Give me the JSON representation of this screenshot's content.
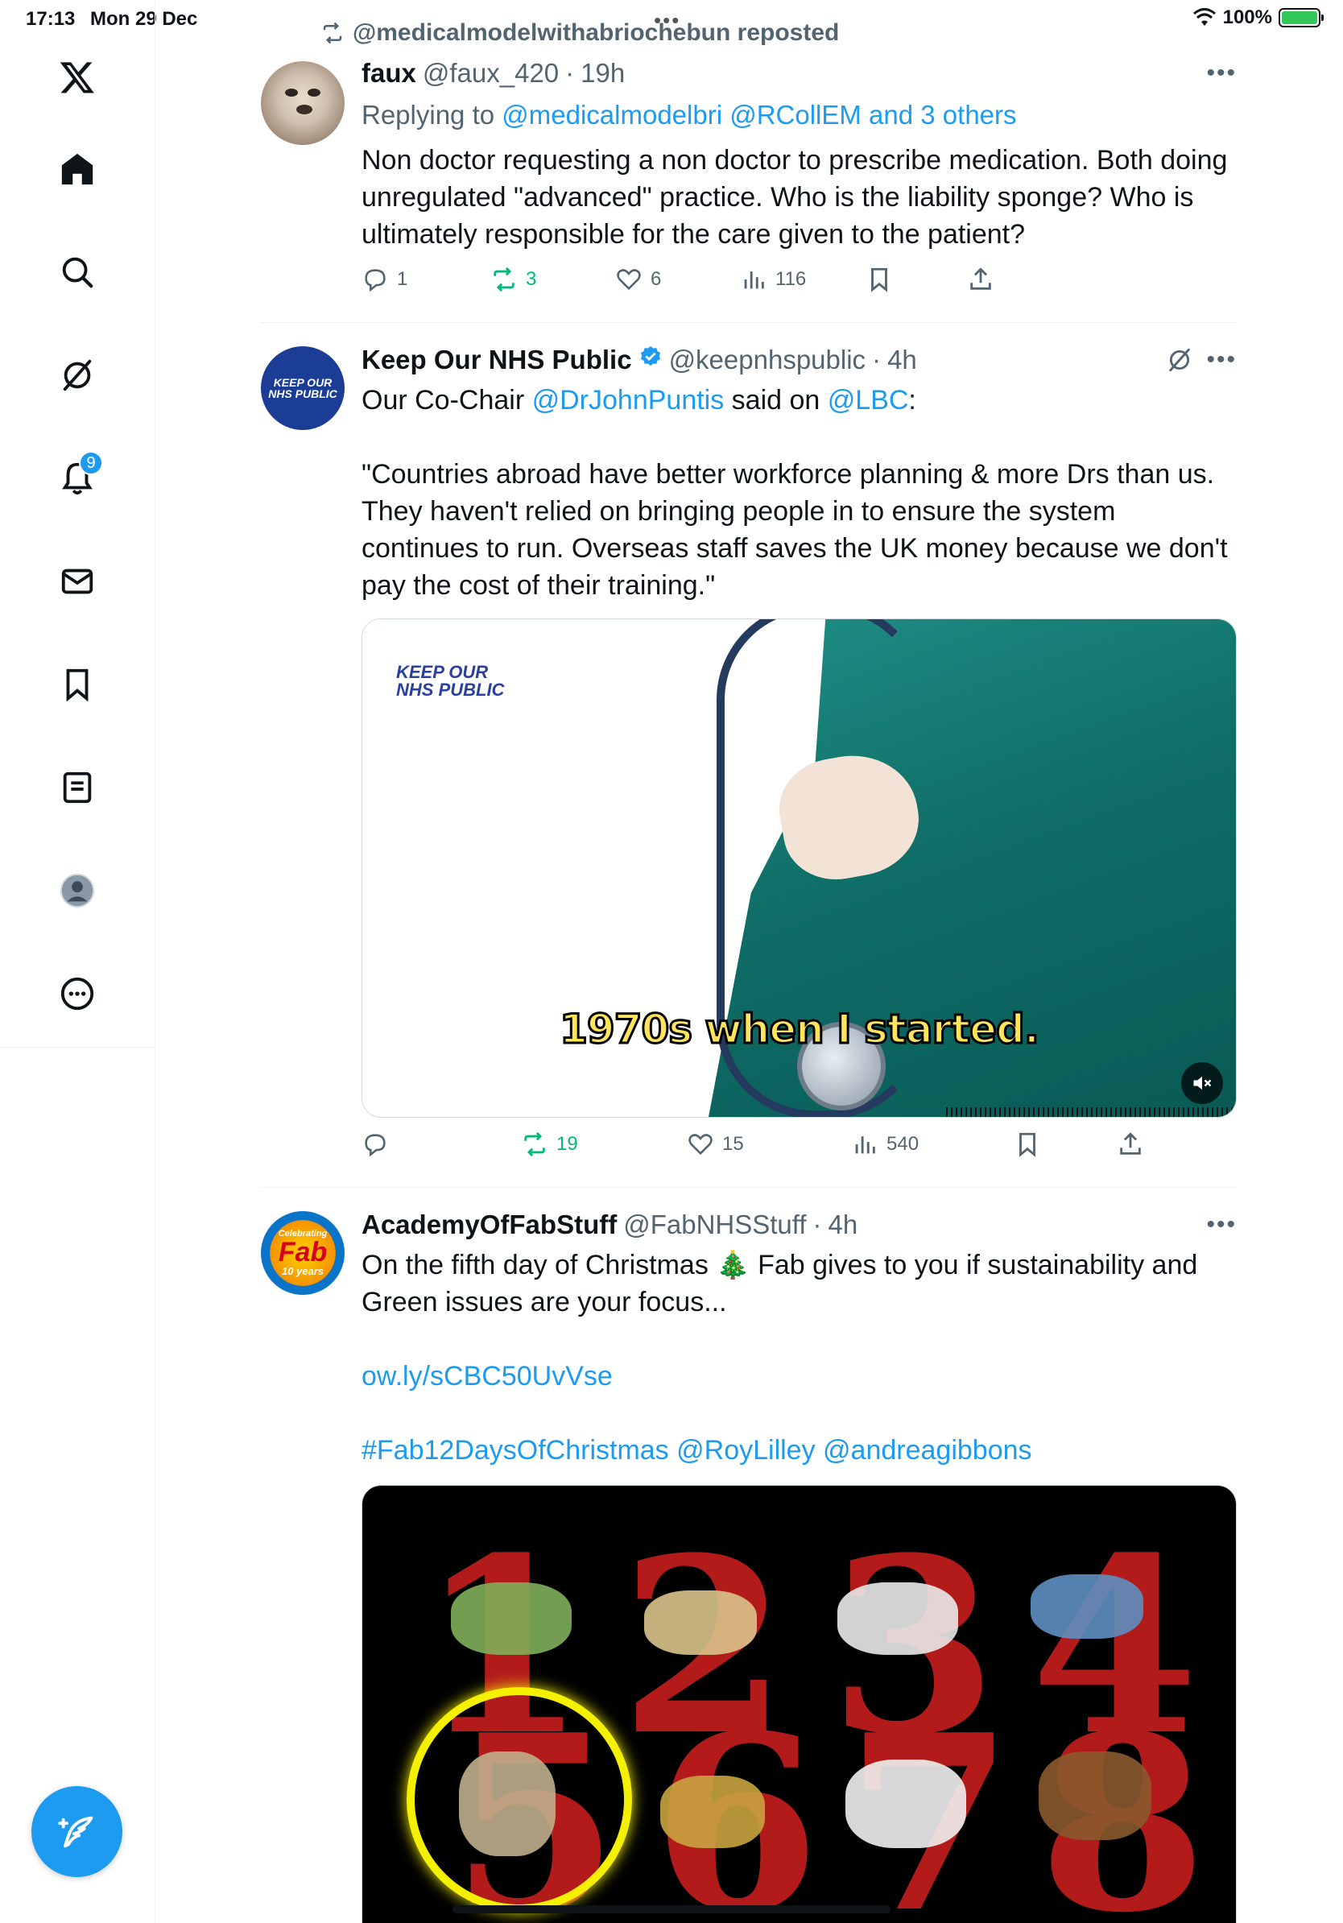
{
  "status_bar": {
    "time": "17:13",
    "date": "Mon 29 Dec",
    "battery": "100%"
  },
  "nav": {
    "notifications_badge": "9"
  },
  "repost_banner": {
    "text": "@medicalmodelwithabriochebun reposted"
  },
  "tweets": [
    {
      "name": "faux",
      "handle": "@faux_420",
      "time": "19h",
      "reply_prefix": "Replying to ",
      "reply_to": "@medicalmodelbri @RCollEM and 3 others",
      "body": "Non doctor requesting a non doctor to prescribe medication. Both doing unregulated \"advanced\" practice. Who is the liability sponge? Who is ultimately responsible for the care given to the patient?",
      "replies": "1",
      "reposts": "3",
      "likes": "6",
      "views": "116"
    },
    {
      "name": "Keep Our NHS Public",
      "handle": "@keepnhspublic",
      "time": "4h",
      "body_1a": "Our Co-Chair ",
      "body_1b": "@DrJohnPuntis",
      "body_1c": " said on ",
      "body_1d": "@LBC",
      "body_1e": ":",
      "body_2": "\"Countries abroad have better workforce planning & more Drs than us. They haven't relied on bringing people in to ensure the system continues to run. Overseas staff saves the UK money because we don't pay the cost of their training.\"",
      "video_logo_1": "KEEP OUR",
      "video_logo_2": "NHS PUBLIC",
      "video_caption": "1970s when I started.",
      "avatar_text_1": "KEEP OUR",
      "avatar_text_2": "NHS PUBLIC",
      "replies": "",
      "reposts": "19",
      "likes": "15",
      "views": "540"
    },
    {
      "name": "AcademyOfFabStuff",
      "handle": "@FabNHSStuff",
      "time": "4h",
      "body_1": "On the fifth day of Christmas 🎄 Fab gives to you if sustainability and Green issues are your focus...",
      "link": "ow.ly/sCBC50UvVse",
      "hashtags": "#Fab12DaysOfChristmas @RoyLilley @andreagibbons",
      "avatar_text_1": "Celebrating",
      "avatar_text_2": "Fab",
      "avatar_text_3": "10 years",
      "image_numbers": [
        "1",
        "2",
        "3",
        "4",
        "5",
        "6",
        "7",
        "8"
      ]
    }
  ]
}
